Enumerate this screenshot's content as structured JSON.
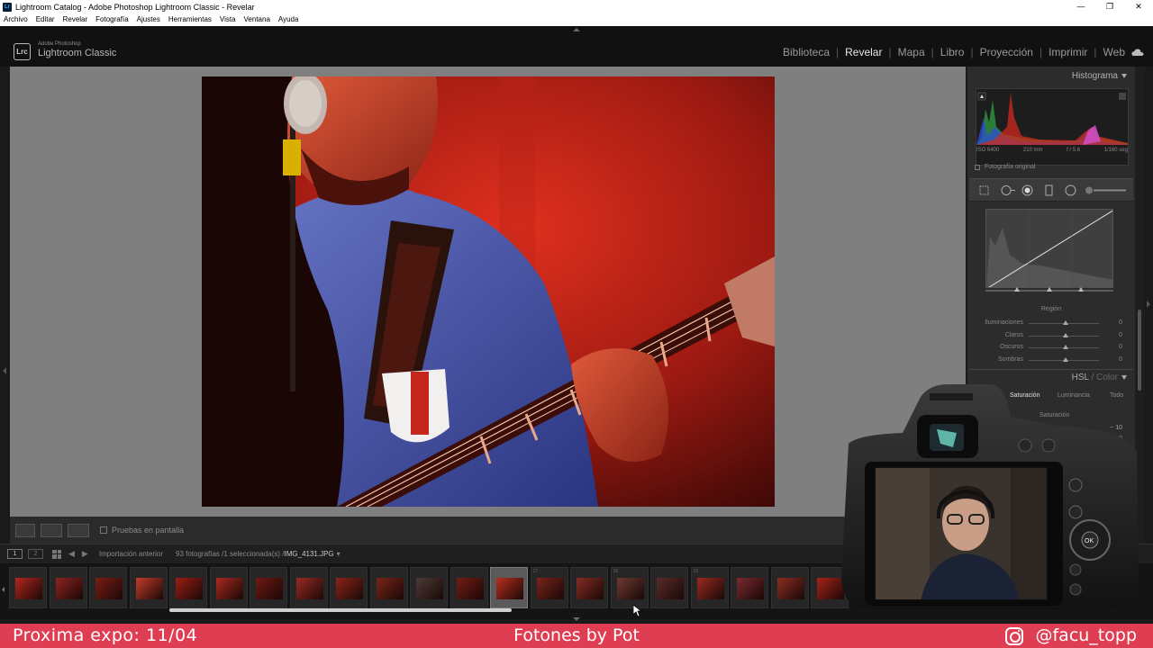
{
  "window": {
    "title": "Lightroom Catalog - Adobe Photoshop Lightroom Classic - Revelar",
    "controls": [
      "—",
      "❐",
      "✕"
    ]
  },
  "menu": [
    "Archivo",
    "Editar",
    "Revelar",
    "Fotografía",
    "Ajustes",
    "Herramientas",
    "Vista",
    "Ventana",
    "Ayuda"
  ],
  "brand": {
    "badge": "Lrc",
    "small": "Adobe Photoshop",
    "big": "Lightroom Classic"
  },
  "modules": [
    {
      "label": "Biblioteca",
      "active": false
    },
    {
      "label": "Revelar",
      "active": true
    },
    {
      "label": "Mapa",
      "active": false
    },
    {
      "label": "Libro",
      "active": false
    },
    {
      "label": "Proyección",
      "active": false
    },
    {
      "label": "Imprimir",
      "active": false
    },
    {
      "label": "Web",
      "active": false
    }
  ],
  "toolbar": {
    "soft_proof_label": "Pruebas en pantalla"
  },
  "filmstrip_header": {
    "page1": "1",
    "page2": "2",
    "source": "Importación anterior",
    "count": "93 fotografías /1 seleccionada(s) /",
    "filename": "IMG_4131.JPG",
    "dropdown_glyph": "▾"
  },
  "filmstrip": {
    "thumb_colors": [
      "#b3261d",
      "#8f2320",
      "#7d1d16",
      "#c43c2c",
      "#9c1d15",
      "#a82a1f",
      "#6f1a12",
      "#9b2b22",
      "#8c2418",
      "#7a2519",
      "#4c3a36",
      "#741d14",
      "#b82f20",
      "#7a241c",
      "#852c22",
      "#6e3a33",
      "#5a2c2a",
      "#9a2b20",
      "#7c2a31",
      "#8b2e22",
      "#a7231a"
    ],
    "selected_index": 12,
    "numbers": [
      "",
      "",
      "",
      "",
      "",
      "",
      "",
      "",
      "",
      "",
      "",
      "",
      "",
      "17",
      "",
      "18",
      "",
      "19",
      "",
      "",
      ""
    ]
  },
  "histogram": {
    "title": "Histograma",
    "iso": "ISO 6400",
    "focal": "210 mm",
    "aperture": "f / 5.6",
    "shutter": "1/160 seg",
    "original_label": "Fotografía original"
  },
  "tone_curve": {
    "region_label": "Región",
    "rows": [
      {
        "label": "Iluminaciones",
        "value": "0"
      },
      {
        "label": "Claros",
        "value": "0"
      },
      {
        "label": "Oscuros",
        "value": "0"
      },
      {
        "label": "Sombras",
        "value": "0"
      }
    ]
  },
  "hsl": {
    "title_hsl": "HSL",
    "title_sep": " / ",
    "title_color": "Color",
    "tabs": [
      {
        "label": "Saturación",
        "active": true
      },
      {
        "label": "Luminancia",
        "active": false
      },
      {
        "label": "Todo",
        "active": false
      }
    ],
    "section_label": "Saturación",
    "value_1": "− 10",
    "value_2": "0"
  },
  "banner": {
    "left": "Proxima expo: 11/04",
    "center": "Fotones by Pot",
    "right": "@facu_topp"
  },
  "colors": {
    "banner": "#df3e52",
    "canvas_gray": "#7f7f7f",
    "panel": "#2c2c2c"
  }
}
